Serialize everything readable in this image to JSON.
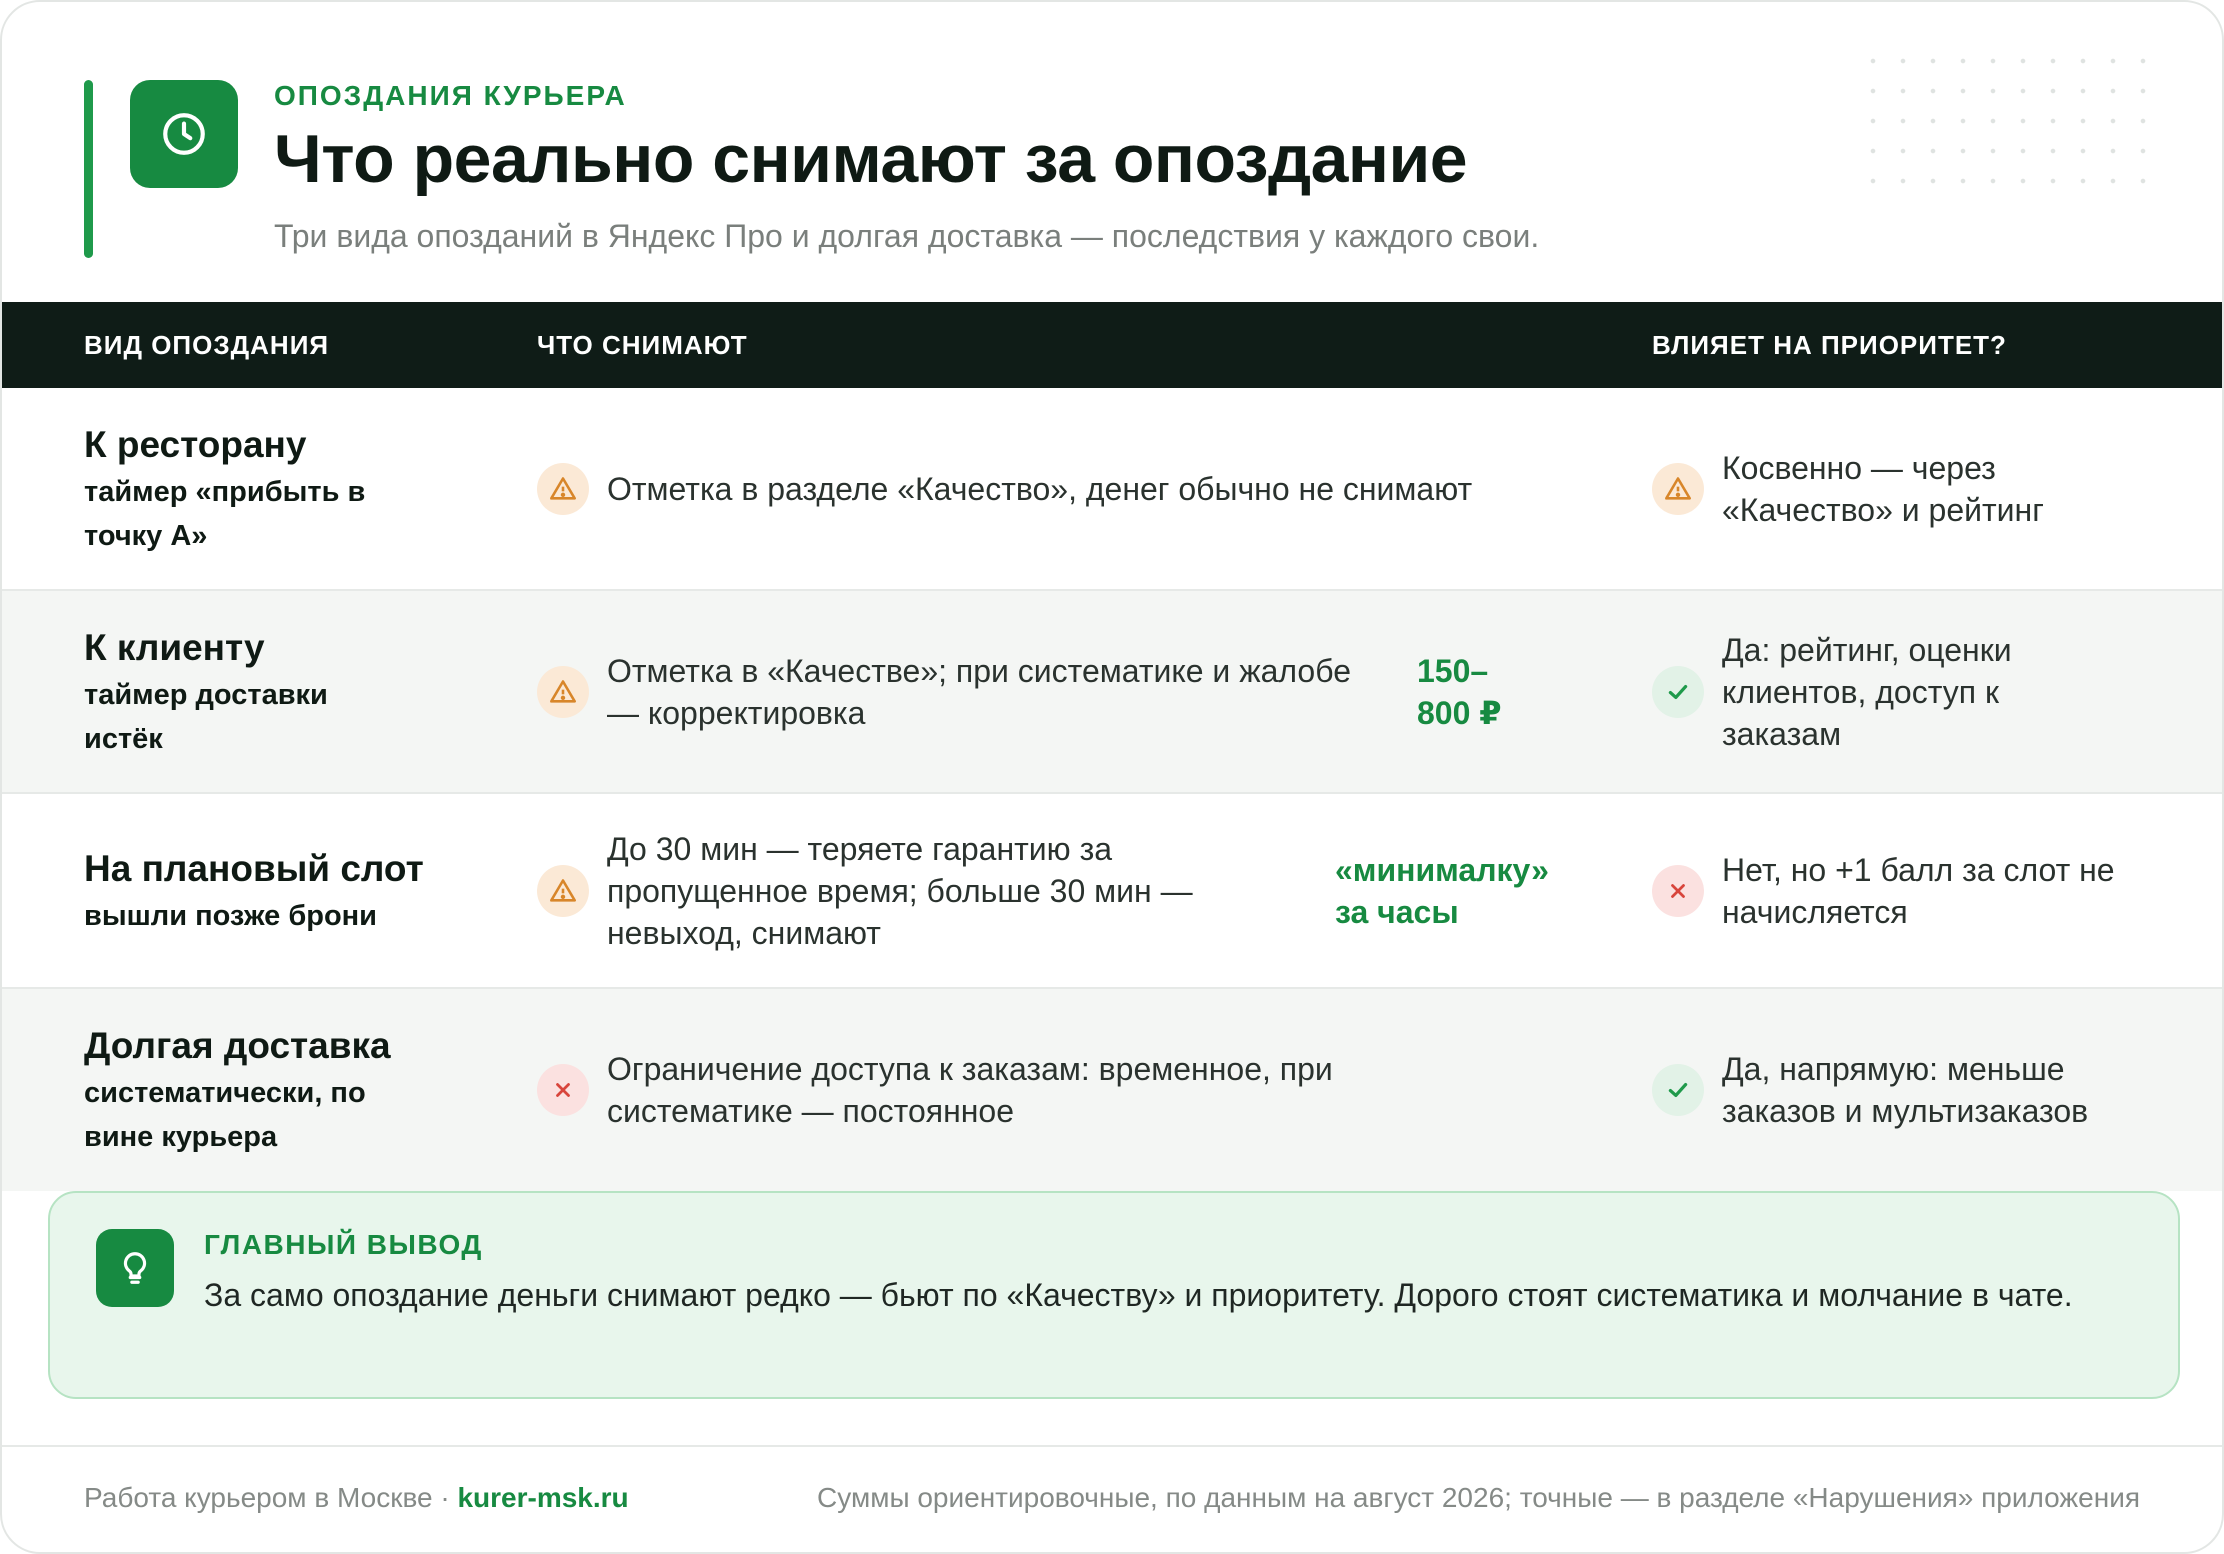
{
  "header": {
    "eyebrow": "ОПОЗДАНИЯ КУРЬЕРА",
    "title": "Что реально снимают за опоздание",
    "subtitle": "Три вида опозданий в Яндекс Про и долгая доставка — последствия у каждого свои.",
    "icon": "clock-icon"
  },
  "table": {
    "headers": [
      "ВИД ОПОЗДАНИЯ",
      "ЧТО СНИМАЮТ",
      "ВЛИЯЕТ НА ПРИОРИТЕТ?"
    ],
    "rows": [
      {
        "type_title": "К ресторану",
        "type_sub": "таймер «прибыть в точку А»",
        "penalty_icon": "warning-icon",
        "penalty": "Отметка в разделе «Качество», денег обычно не снимают",
        "amount": "",
        "priority_icon": "warning-icon",
        "priority": "Косвенно — через «Качество» и рейтинг"
      },
      {
        "type_title": "К клиенту",
        "type_sub": "таймер доставки истёк",
        "penalty_icon": "warning-icon",
        "penalty": "Отметка в «Качестве»; при систематике и жалобе — корректировка",
        "amount": "150–800 ₽",
        "priority_icon": "check-icon",
        "priority": "Да: рейтинг, оценки клиентов, доступ к заказам"
      },
      {
        "type_title": "На плановый слот",
        "type_sub": "вышли позже брони",
        "penalty_icon": "warning-icon",
        "penalty": "До 30 мин — теряете гарантию за пропущенное время; больше 30 мин — невыход, снимают",
        "amount": "«минималку» за часы",
        "priority_icon": "cross-icon",
        "priority": "Нет, но +1 балл за слот не начисляется"
      },
      {
        "type_title": "Долгая доставка",
        "type_sub": "систематически, по вине курьера",
        "penalty_icon": "cross-icon",
        "penalty": "Ограничение доступа к заказам: временное, при систематике — постоянное",
        "amount": "",
        "priority_icon": "check-icon",
        "priority": "Да, напрямую: меньше заказов и мультизаказов"
      }
    ]
  },
  "conclusion": {
    "label": "ГЛАВНЫЙ ВЫВОД",
    "text": "За само опоздание деньги снимают редко — бьют по «Качеству» и приоритету. Дорого стоят систематика и молчание в чате.",
    "icon": "lightbulb-icon"
  },
  "footer": {
    "left": "Работа курьером в Москве · ",
    "site": "kurer-msk.ru",
    "right": "Суммы ориентировочные, по данным на август 2026; точные — в разделе «Нарушения» приложения"
  },
  "colors": {
    "accent": "#178a41",
    "header_bg": "#0f1c17",
    "warning": "#d8862a",
    "ok": "#1f9a4b",
    "error": "#d8453c"
  }
}
